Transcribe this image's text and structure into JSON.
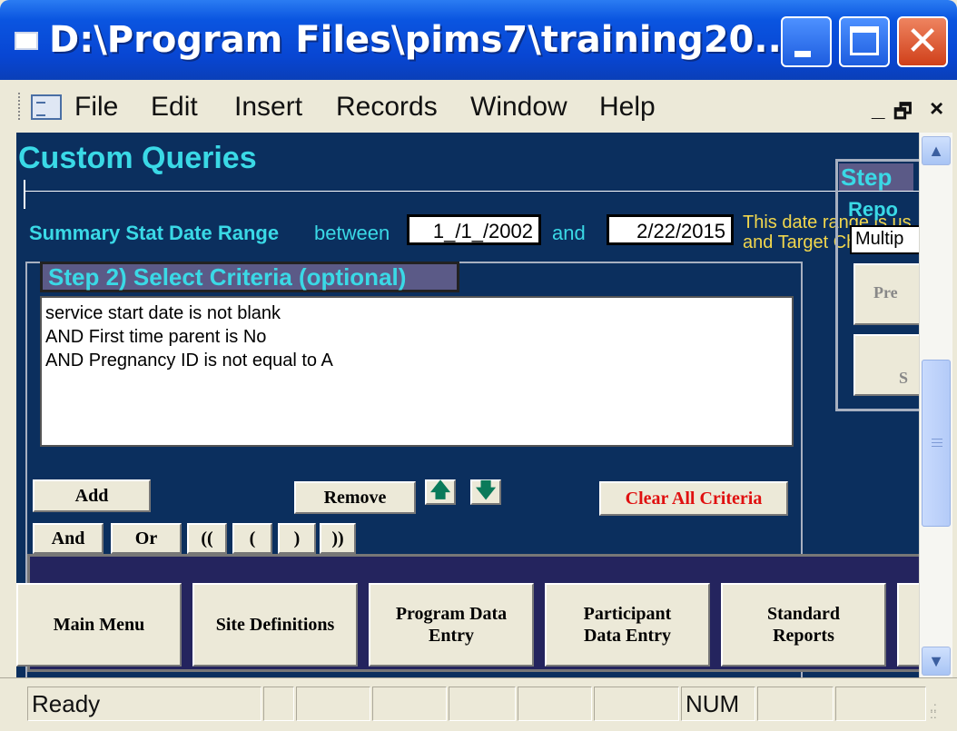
{
  "window": {
    "title": "D:\\Program Files\\pims7\\training20...",
    "min_label": "",
    "close_label": "✕"
  },
  "menu": {
    "items": [
      "File",
      "Edit",
      "Insert",
      "Records",
      "Window",
      "Help"
    ],
    "mdi_minimize": "_",
    "mdi_restore": "🗗",
    "mdi_close": "×"
  },
  "form": {
    "title": "Custom Queries",
    "range_label": "Summary Stat Date Range",
    "between_label": "between",
    "start_date": "1_/1_/2002",
    "and_label": "and",
    "end_date": "2/22/2015",
    "info_line1": "This date range is us",
    "info_line2": "and Target Child Sur"
  },
  "criteria": {
    "header": "Step 2) Select Criteria (optional)",
    "lines": [
      "service start date is not blank",
      "AND First time parent is No",
      "AND Pregnancy ID is not equal to A"
    ],
    "add_label": "Add",
    "remove_label": "Remove",
    "move_up": "🡅",
    "move_down": "🡇",
    "clear_label": "Clear All Criteria",
    "and_label": "And",
    "or_label": "Or",
    "dbl_open": "((",
    "open": "(",
    "close": ")",
    "dbl_close": "))"
  },
  "step_panel": {
    "header": "Step",
    "report_label": "Repo",
    "report_value": "Multip",
    "btn1": "Pre",
    "btn2": "S"
  },
  "nav": {
    "main_menu": "Main Menu",
    "site_definitions": "Site Definitions",
    "program_data_line1": "Program  Data",
    "program_data_line2": "Entry",
    "participant_line1": "Participant",
    "participant_line2": "Data Entry",
    "standard_line1": "Standard",
    "standard_line2": "Reports"
  },
  "status": {
    "text": "Ready",
    "num": "NUM"
  },
  "colors": {
    "form_bg": "#0b2f5e",
    "title_cyan": "#3ad9e6",
    "info_yellow": "#f2d74d",
    "clear_red": "#e01010"
  }
}
